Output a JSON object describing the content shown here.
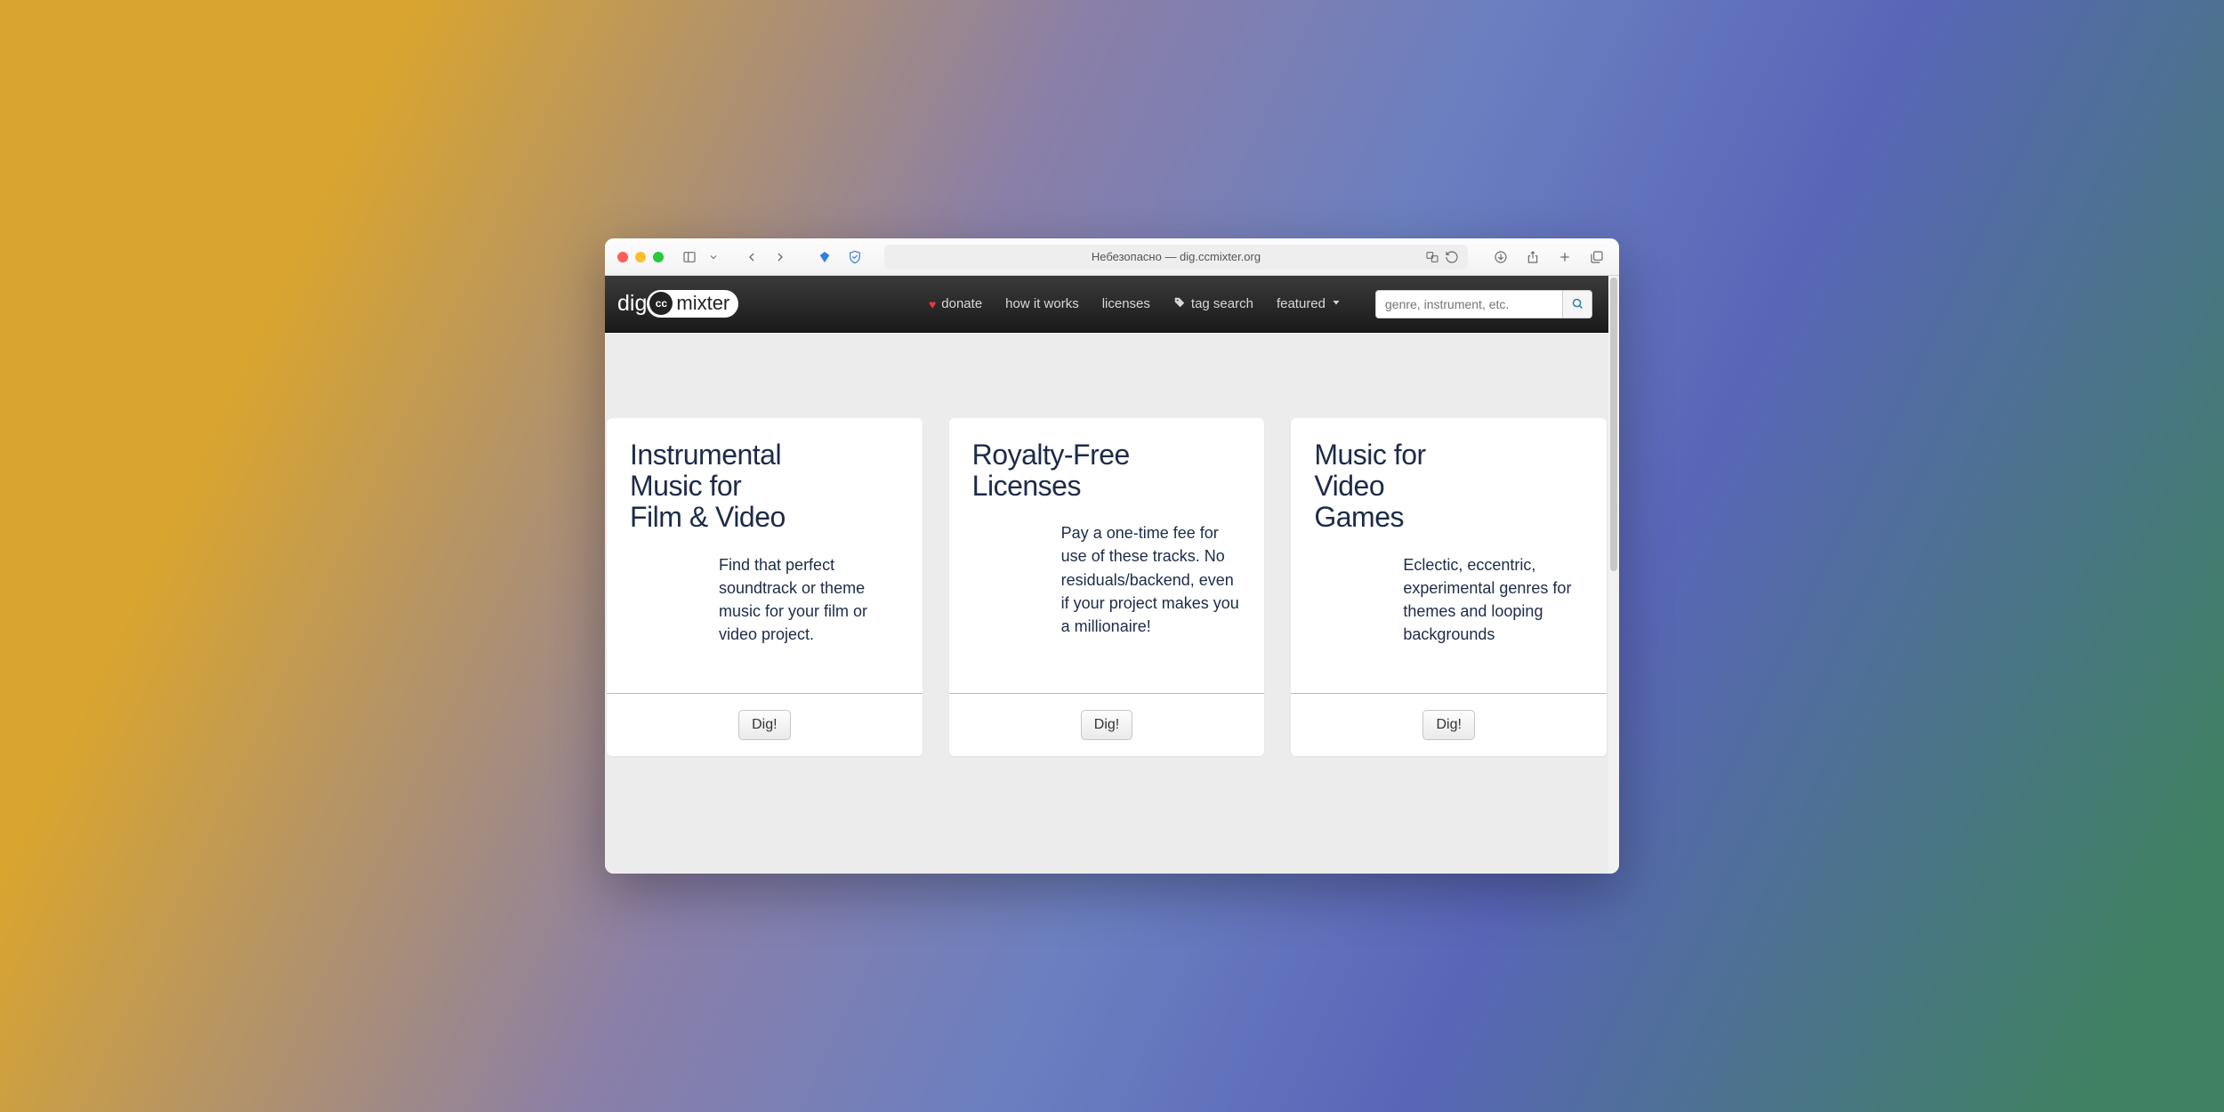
{
  "browser": {
    "address": "Небезопасно — dig.ccmixter.org"
  },
  "logo": {
    "dig": "dig",
    "cc": "cc",
    "mixter": "mixter"
  },
  "nav": {
    "donate": "donate",
    "how_it_works": "how it works",
    "licenses": "licenses",
    "tag_search": "tag search",
    "featured": "featured"
  },
  "search": {
    "placeholder": "genre, instrument, etc."
  },
  "cards": [
    {
      "title": "Instrumental Music for Film & Video",
      "desc": "Find that perfect soundtrack or theme music for your film or video project.",
      "button": "Dig!"
    },
    {
      "title": "Royalty-Free Licenses",
      "desc": "Pay a one-time fee for use of these tracks. No residuals/backend, even if your project makes you a millionaire!",
      "button": "Dig!"
    },
    {
      "title": "Music for Video Games",
      "desc": "Eclectic, eccentric, experimental genres for themes and looping backgrounds",
      "button": "Dig!"
    }
  ]
}
